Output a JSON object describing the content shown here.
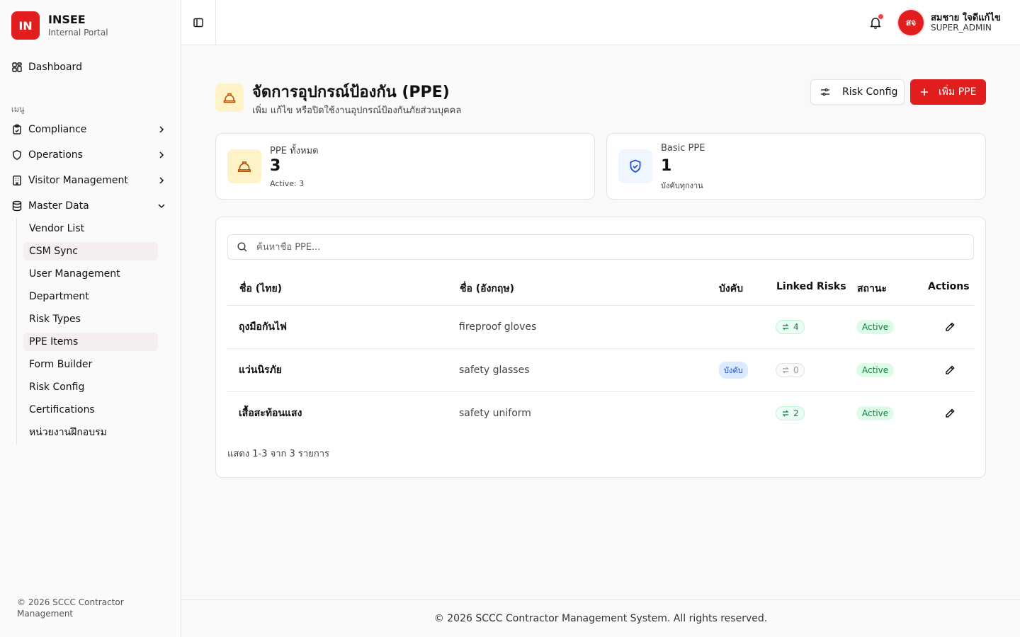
{
  "brand": {
    "logo": "IN",
    "name": "INSEE",
    "subtitle": "Internal Portal"
  },
  "sidebar": {
    "dashboard": "Dashboard",
    "menu_label": "เมนู",
    "groups": [
      {
        "label": "Compliance",
        "icon": "clipboard-check-icon"
      },
      {
        "label": "Operations",
        "icon": "shield-icon"
      },
      {
        "label": "Visitor Management",
        "icon": "building-icon"
      },
      {
        "label": "Master Data",
        "icon": "database-icon"
      }
    ],
    "master_items": [
      {
        "label": "Vendor List"
      },
      {
        "label": "CSM Sync"
      },
      {
        "label": "User Management"
      },
      {
        "label": "Department"
      },
      {
        "label": "Risk Types"
      },
      {
        "label": "PPE Items"
      },
      {
        "label": "Form Builder"
      },
      {
        "label": "Risk Config"
      },
      {
        "label": "Certifications"
      },
      {
        "label": "หน่วยงานฝึกอบรม"
      }
    ],
    "footer": "© 2026 SCCC Contractor Management"
  },
  "header": {
    "user": {
      "initials": "สจ",
      "name": "สมชาย ใจดีแก้ไข",
      "role": "SUPER_ADMIN"
    }
  },
  "page": {
    "title": "จัดการอุปกรณ์ป้องกัน (PPE)",
    "subtitle": "เพิ่ม แก้ไข หรือปิดใช้งานอุปกรณ์ป้องกันภัยส่วนบุคคล",
    "risk_config_label": "Risk Config",
    "add_label": "เพิ่ม PPE"
  },
  "stats": [
    {
      "label": "PPE ทั้งหมด",
      "value": "3",
      "note": "Active: 3"
    },
    {
      "label": "Basic PPE",
      "value": "1",
      "note": "บังคับทุกงาน"
    }
  ],
  "table": {
    "search_placeholder": "ค้นหาชื่อ PPE...",
    "headers": {
      "name_th": "ชื่อ (ไทย)",
      "name_en": "ชื่อ (อังกฤษ)",
      "required": "บังคับ",
      "linked": "Linked Risks",
      "status": "สถานะ",
      "actions": "Actions"
    },
    "rows": [
      {
        "name_th": "ถุงมือกันไฟ",
        "name_en": "fireproof gloves",
        "required": "",
        "linked": "4",
        "status": "Active"
      },
      {
        "name_th": "แว่นนิรภัย",
        "name_en": "safety glasses",
        "required": "บังคับ",
        "linked": "0",
        "status": "Active"
      },
      {
        "name_th": "เสื้อสะท้อนแสง",
        "name_en": "safety uniform",
        "required": "",
        "linked": "2",
        "status": "Active"
      }
    ],
    "pager": "แสดง 1-3 จาก 3 รายการ"
  },
  "footer": "© 2026 SCCC Contractor Management System. All rights reserved.",
  "colors": {
    "brand": "#e11d1d",
    "active_bg": "#dcfce7",
    "required_bg": "#dbeafe",
    "ppe_icon_bg": "#fef3c7"
  }
}
